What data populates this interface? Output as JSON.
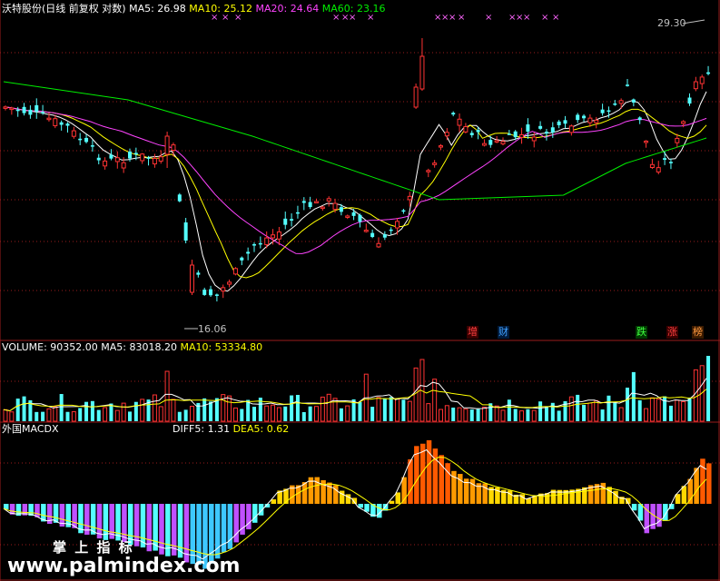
{
  "main_legend": {
    "title": "沃特股份(日线 前复权 对数)",
    "ma5": "MA5: 26.98",
    "ma10": "MA10: 25.12",
    "ma20": "MA20: 24.64",
    "ma60": "MA60: 23.16"
  },
  "price_high_label": "29.30",
  "price_low_label": "16.06",
  "signal_tags": {
    "zeng": "增",
    "cai": "财",
    "die": "跌",
    "zhang": "涨",
    "bang": "榜"
  },
  "volume_legend": {
    "volume": "VOLUME: 90352.00",
    "ma5": "MA5: 83018.20",
    "ma10": "MA10: 53334.80"
  },
  "macd_legend": {
    "title": "外国MACDX",
    "diff": "DIFF5: 1.31",
    "dea": "DEA5: 0.62"
  },
  "watermark": {
    "line1": "掌 上 指 标",
    "line2": "www.palmindex.com"
  },
  "colors": {
    "background": "#000000",
    "up": "#ff3333",
    "down": "#54ffff",
    "ma5": "#ffffff",
    "ma10": "#ffff00",
    "ma20": "#ff44ff",
    "ma60": "#00ee00",
    "grid": "#9a1c1c"
  },
  "chart_data": {
    "type": "candlestick",
    "price_range": [
      16.06,
      29.3
    ],
    "price_scale": "log",
    "sessions": 114,
    "price_series": [
      {
        "name": "MA5",
        "value": 26.98
      },
      {
        "name": "MA10",
        "value": 25.12
      },
      {
        "name": "MA20",
        "value": 24.64
      },
      {
        "name": "MA60",
        "value": 23.16
      }
    ],
    "volume": {
      "value": 90352.0,
      "ma5": 83018.2,
      "ma10": 53334.8
    },
    "macd": {
      "diff5": 1.31,
      "dea5": 0.62
    }
  }
}
